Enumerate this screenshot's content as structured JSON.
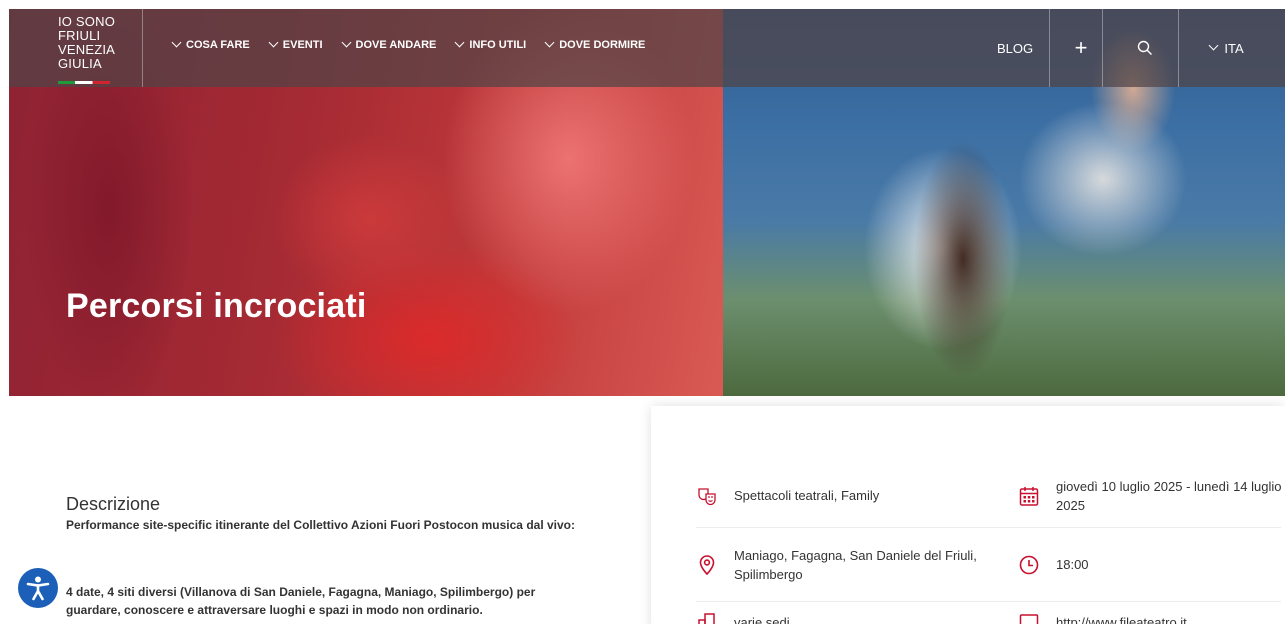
{
  "brand": {
    "logo_lines": [
      "IO SONO",
      "FRIULI",
      "VENEZIA",
      "GIULIA"
    ]
  },
  "nav": {
    "menu": [
      {
        "label": "COSA FARE"
      },
      {
        "label": "EVENTI"
      },
      {
        "label": "DOVE ANDARE"
      },
      {
        "label": "INFO UTILI"
      },
      {
        "label": "DOVE DORMIRE"
      }
    ],
    "blog_label": "BLOG",
    "plus_glyph": "+",
    "language": "ITA"
  },
  "hero": {
    "title": "Percorsi incrociati"
  },
  "description": {
    "heading": "Descrizione",
    "paragraph1": "Performance site-specific itinerante del Collettivo Azioni Fuori Postocon musica dal vivo:",
    "paragraph2": "4 date, 4 siti diversi (Villanova di San Daniele, Fagagna, Maniago, Spilimbergo) per guardare, conoscere e attraversare luoghi e spazi in modo non ordinario."
  },
  "info": {
    "category": "Spettacoli teatrali, Family",
    "dates": "giovedì 10 luglio 2025 - lunedì 14 luglio 2025",
    "location": "Maniago, Fagagna, San Daniele del Friuli, Spilimbergo",
    "time": "18:00",
    "venue": "varie sedi",
    "website": "http://www.fileateatro.it"
  },
  "colors": {
    "accent": "#c8102e",
    "a11y": "#1b5fb8"
  }
}
